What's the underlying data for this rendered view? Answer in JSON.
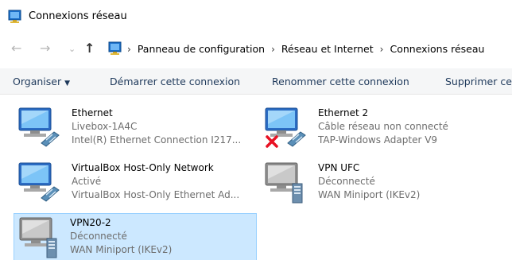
{
  "window": {
    "title": "Connexions réseau"
  },
  "address": {
    "crumbs": [
      "Panneau de configuration",
      "Réseau et Internet",
      "Connexions réseau"
    ]
  },
  "toolbar": {
    "organize": "Organiser",
    "start": "Démarrer cette connexion",
    "rename": "Renommer cette connexion",
    "delete": "Supprimer ce"
  },
  "connections": [
    {
      "name": "Ethernet",
      "status": "Livebox-1A4C",
      "device": "Intel(R) Ethernet Connection I217...",
      "icon": "ethernet-adapter-icon"
    },
    {
      "name": "Ethernet 2",
      "status": "Câble réseau non connecté",
      "device": "TAP-Windows Adapter V9",
      "icon": "ethernet-adapter-disconnected-icon"
    },
    {
      "name": "VirtualBox Host-Only Network",
      "status": "Activé",
      "device": "VirtualBox Host-Only Ethernet Ad...",
      "icon": "ethernet-adapter-icon"
    },
    {
      "name": "VPN UFC",
      "status": "Déconnecté",
      "device": "WAN Miniport (IKEv2)",
      "icon": "vpn-adapter-icon"
    },
    {
      "name": "VPN20-2",
      "status": "Déconnecté",
      "device": "WAN Miniport (IKEv2)",
      "icon": "vpn-adapter-icon"
    }
  ],
  "colors": {
    "accent": "#cce8ff",
    "toolbar_text": "#1e395b",
    "error": "#e81123"
  }
}
